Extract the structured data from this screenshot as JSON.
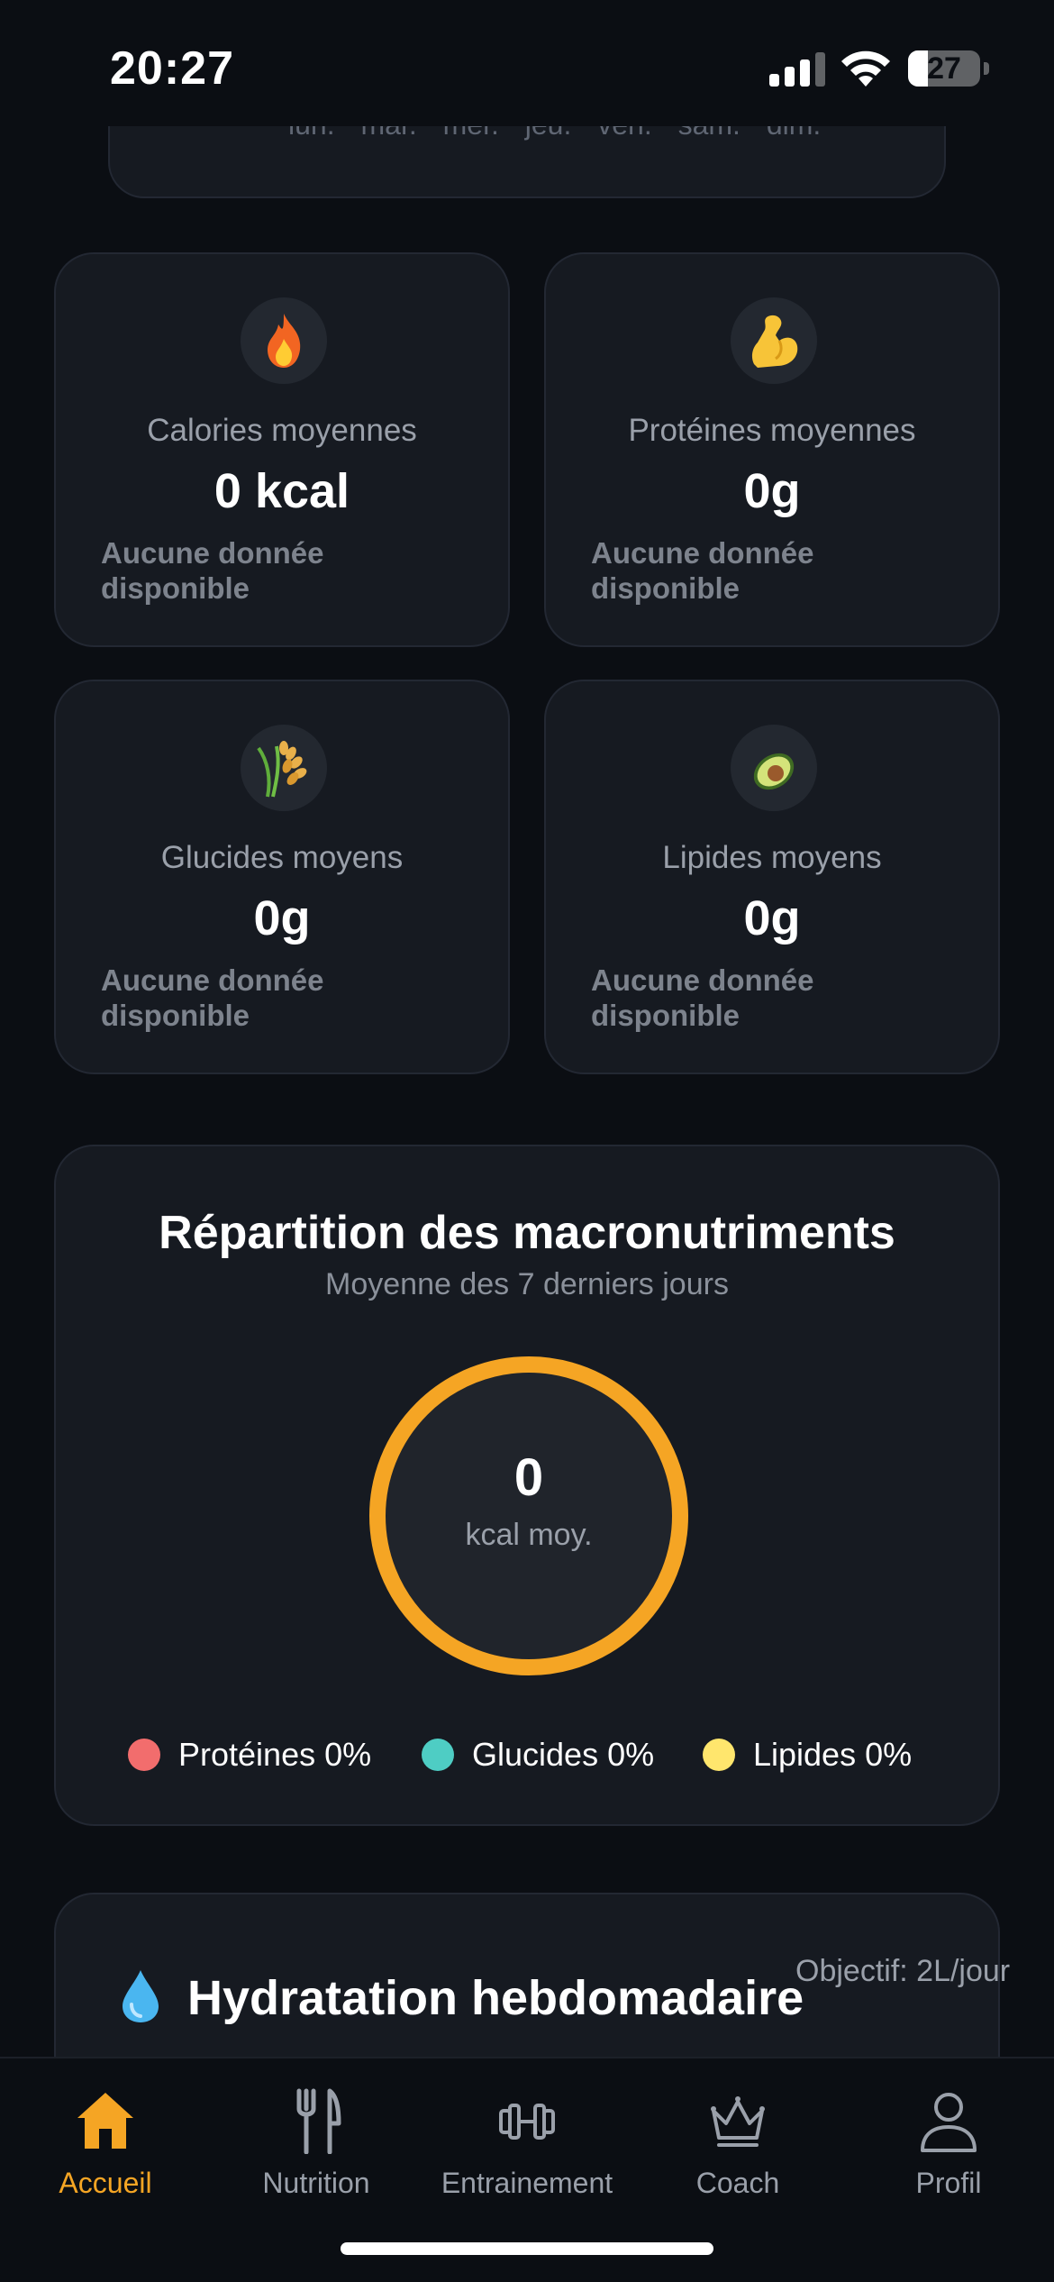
{
  "status_bar": {
    "time": "20:27",
    "battery": "27",
    "battery_level": 0.27
  },
  "week_card": {
    "days": [
      "lun.",
      "mar.",
      "mer.",
      "jeu.",
      "ven.",
      "sam.",
      "dim."
    ]
  },
  "stats": [
    {
      "icon": "fire-icon",
      "label": "Calories moyennes",
      "value": "0 kcal",
      "note": "Aucune donnée disponible"
    },
    {
      "icon": "flexed-biceps-icon",
      "label": "Protéines moyennes",
      "value": "0g",
      "note": "Aucune donnée disponible"
    },
    {
      "icon": "rice-icon",
      "label": "Glucides moyens",
      "value": "0g",
      "note": "Aucune donnée disponible"
    },
    {
      "icon": "avocado-icon",
      "label": "Lipides moyens",
      "value": "0g",
      "note": "Aucune donnée disponible"
    }
  ],
  "macros": {
    "title": "Répartition des macronutriments",
    "subtitle": "Moyenne des 7 derniers jours",
    "center_value": "0",
    "center_unit": "kcal moy.",
    "ring_color": "#f5a524",
    "legend": [
      {
        "label": "Protéines 0%",
        "color": "#f26d6d"
      },
      {
        "label": "Glucides 0%",
        "color": "#4ecdc4"
      },
      {
        "label": "Lipides 0%",
        "color": "#ffe66d"
      }
    ]
  },
  "hydration": {
    "icon": "water-drop-icon",
    "title": "Hydratation hebdomadaire",
    "goal": "Objectif: 2L/jour"
  },
  "tab_bar": {
    "active_color": "#f5a524",
    "tabs": [
      {
        "label": "Accueil",
        "icon": "home-icon",
        "active": true
      },
      {
        "label": "Nutrition",
        "icon": "fork-knife-icon",
        "active": false
      },
      {
        "label": "Entrainement",
        "icon": "dumbbell-icon",
        "active": false
      },
      {
        "label": "Coach",
        "icon": "crown-icon",
        "active": false
      },
      {
        "label": "Profil",
        "icon": "user-icon",
        "active": false
      }
    ]
  }
}
